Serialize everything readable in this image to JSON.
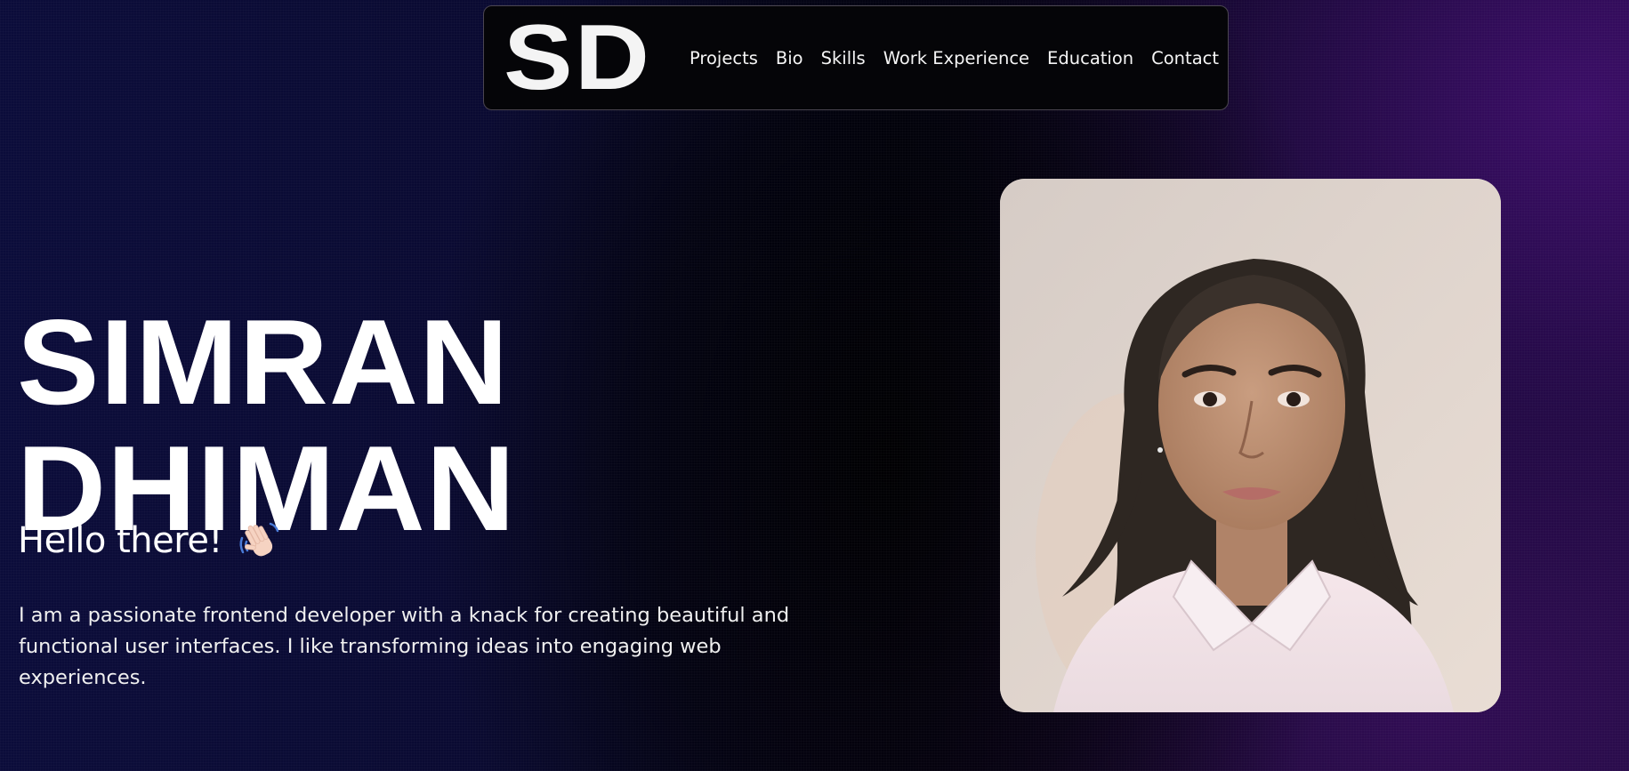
{
  "brand": {
    "logo_text": "SD"
  },
  "nav": {
    "items": [
      {
        "label": "Projects"
      },
      {
        "label": "Bio"
      },
      {
        "label": "Skills"
      },
      {
        "label": "Work Experience"
      },
      {
        "label": "Education"
      },
      {
        "label": "Contact"
      }
    ]
  },
  "hero": {
    "first_name": "SIMRAN",
    "last_name": "DHIMAN",
    "greeting": "Hello there!",
    "greeting_icon": "waving-hand-icon",
    "bio": "I am a passionate frontend developer with a knack for creating beautiful and functional user interfaces. I like transforming ideas into engaging web experiences."
  },
  "colors": {
    "background_left": "#0b0c3a",
    "background_right": "#1f0a3e",
    "navbar_bg": "#050508",
    "text": "#ffffff"
  }
}
